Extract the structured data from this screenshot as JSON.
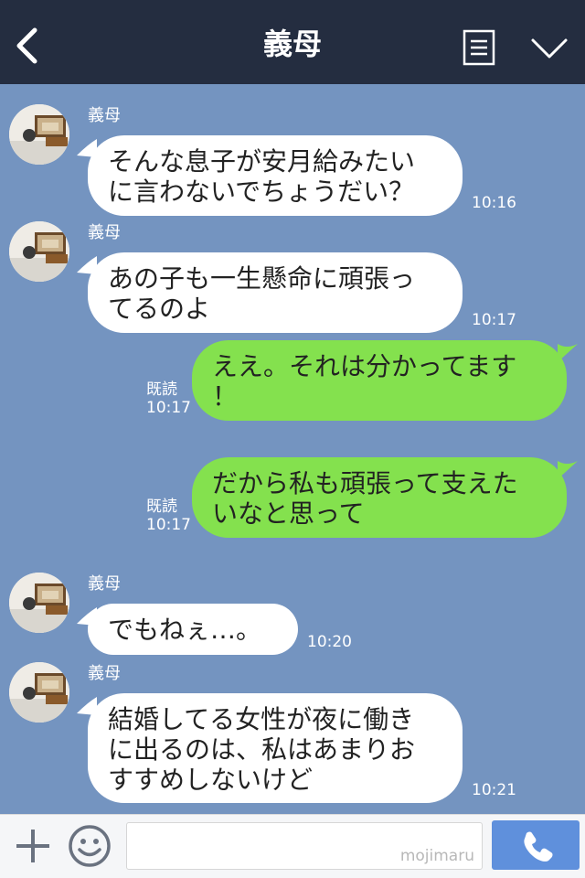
{
  "header": {
    "title": "義母",
    "back_icon": "chevron-left-icon",
    "menu_icon": "list-icon",
    "dropdown_icon": "chevron-down-icon"
  },
  "messages": [
    {
      "direction": "in",
      "sender": "義母",
      "lines": [
        "そんな息子が安月給みたい",
        "に言わないでちょうだい？"
      ],
      "time": "10:16"
    },
    {
      "direction": "in",
      "sender": "義母",
      "lines": [
        "あの子も一生懸命に頑張っ",
        "てるのよ"
      ],
      "time": "10:17"
    },
    {
      "direction": "out",
      "read": "既読",
      "lines": [
        "ええ。それは分かってます",
        "！"
      ],
      "time": "10:17"
    },
    {
      "direction": "out",
      "read": "既読",
      "lines": [
        "だから私も頑張って支えた",
        "いなと思って"
      ],
      "time": "10:17"
    },
    {
      "direction": "in",
      "sender": "義母",
      "lines": [
        "でもねぇ…。"
      ],
      "time": "10:20"
    },
    {
      "direction": "in",
      "sender": "義母",
      "lines": [
        "結婚してる女性が夜に働き",
        "に出るのは、私はあまりお",
        "すすめしないけど"
      ],
      "time": "10:21"
    }
  ],
  "footer": {
    "watermark": "mojimaru",
    "plus_icon": "plus-icon",
    "emoji_icon": "smiley-icon",
    "call_icon": "phone-icon"
  },
  "colors": {
    "header_bg": "#242d40",
    "chat_bg": "#7494c0",
    "incoming_bubble": "#ffffff",
    "outgoing_bubble": "#84e14e",
    "call_button": "#5f90dc"
  }
}
